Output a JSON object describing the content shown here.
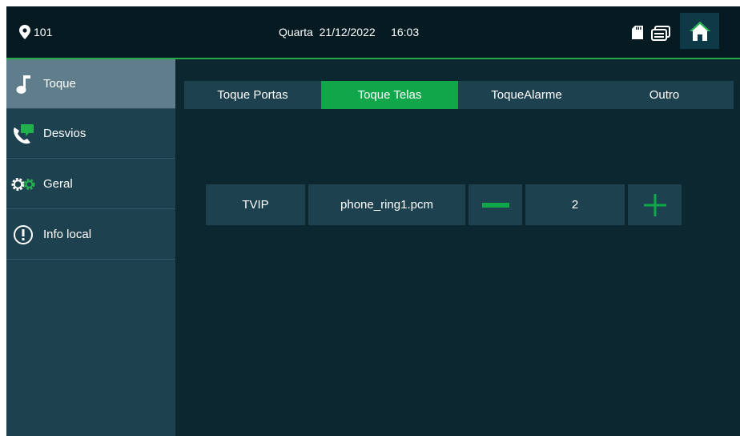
{
  "topbar": {
    "room": "101",
    "datetime": "Quarta  21/12/2022     16:03",
    "icons": [
      "location-icon",
      "sd-card-icon",
      "message-icon",
      "home-icon"
    ]
  },
  "sidebar": {
    "items": [
      {
        "label": "Toque",
        "icon": "music-note-icon",
        "active": true
      },
      {
        "label": "Desvios",
        "icon": "call-forward-icon",
        "active": false
      },
      {
        "label": "Geral",
        "icon": "gears-icon",
        "active": false
      },
      {
        "label": "Info local",
        "icon": "info-icon",
        "active": false
      }
    ]
  },
  "tabs": [
    {
      "label": "Toque Portas",
      "active": false
    },
    {
      "label": "Toque Telas",
      "active": true
    },
    {
      "label": "ToqueAlarme",
      "active": false
    },
    {
      "label": "Outro",
      "active": false
    }
  ],
  "ring": {
    "device": "TVIP",
    "file": "phone_ring1.pcm",
    "volume": "2"
  },
  "colors": {
    "accent": "#0fa74a",
    "background": "#0c2730",
    "panel": "#1e4150",
    "active_sidebar": "#5f7d8a"
  }
}
